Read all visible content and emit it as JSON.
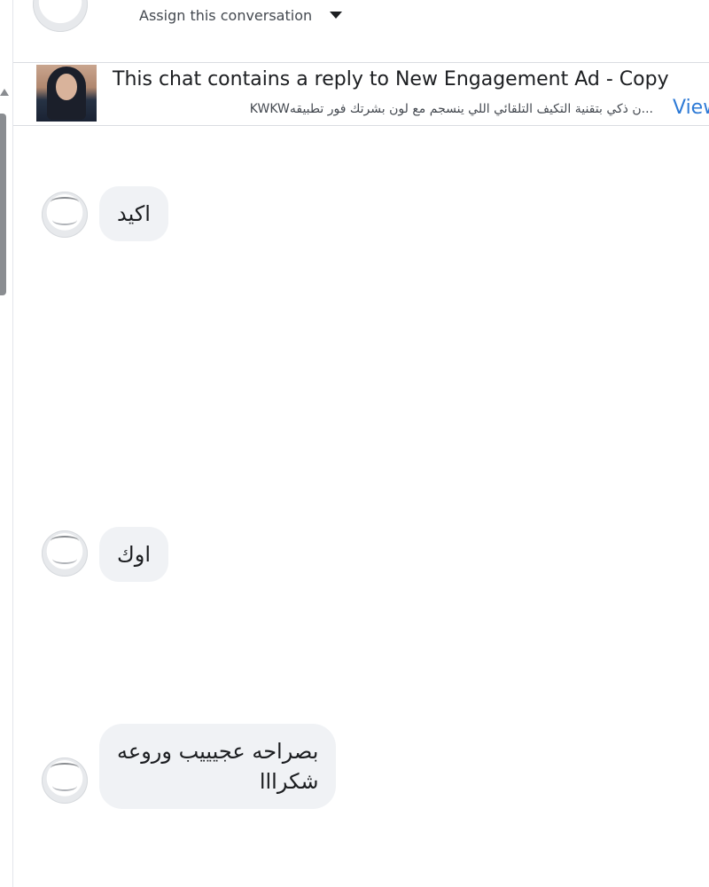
{
  "assign": {
    "label": "Assign this conversation",
    "icon": "chevron-down-icon"
  },
  "ad_banner": {
    "title": "This chat contains a reply to New Engagement Ad - Copy",
    "preview": "...ن ذكي بتقنية التكيف التلقائي اللي ينسجم مع لون بشرتك فور تطبيقهKWKW",
    "view_label": "View"
  },
  "messages": [
    {
      "text": "اكيد"
    },
    {
      "text": "اوك"
    },
    {
      "line1": "بصراحه عجيييب  وروعه",
      "line2": "شكرااا"
    }
  ],
  "colors": {
    "bubble_bg": "#f0f2f5",
    "link": "#2d7ad6",
    "divider": "#dadde1"
  }
}
